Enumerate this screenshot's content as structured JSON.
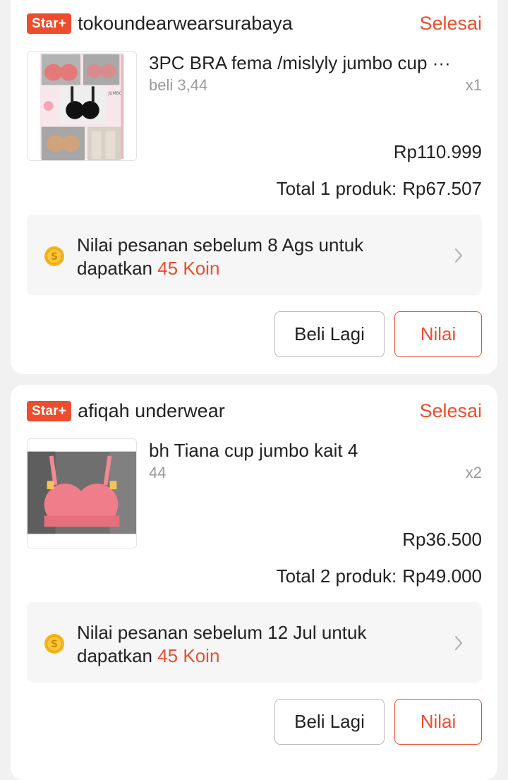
{
  "orders": [
    {
      "badge": "Star+",
      "shop_name": "tokoundearwearsurabaya",
      "status": "Selesai",
      "product_image": "bra-product-collage",
      "product_title": "3PC BRA fema /mislyly jumbo cup ···",
      "variant": "beli 3,44",
      "quantity": "x1",
      "price": "Rp110.999",
      "total_label": "Total 1 produk:",
      "total_amount": "Rp67.507",
      "coin_text": "Nilai pesanan sebelum 8 Ags untuk dapatkan",
      "coin_reward": "45 Koin",
      "buy_again_label": "Beli Lagi",
      "rate_label": "Nilai"
    },
    {
      "badge": "Star+",
      "shop_name": "afiqah underwear",
      "status": "Selesai",
      "product_image": "pink-bra-photo",
      "product_title": "bh Tiana cup jumbo kait 4",
      "variant": "44",
      "quantity": "x2",
      "price": "Rp36.500",
      "total_label": "Total 2 produk:",
      "total_amount": "Rp49.000",
      "coin_text": "Nilai pesanan sebelum 12 Jul untuk dapatkan",
      "coin_reward": "45 Koin",
      "buy_again_label": "Beli Lagi",
      "rate_label": "Nilai"
    }
  ],
  "colors": {
    "accent": "#ee4d2d",
    "text": "#222222",
    "muted": "#9a9a9a",
    "coin": "#f5b51b"
  },
  "icons": {
    "coin": "coin-icon",
    "chevron": "chevron-right-icon"
  }
}
